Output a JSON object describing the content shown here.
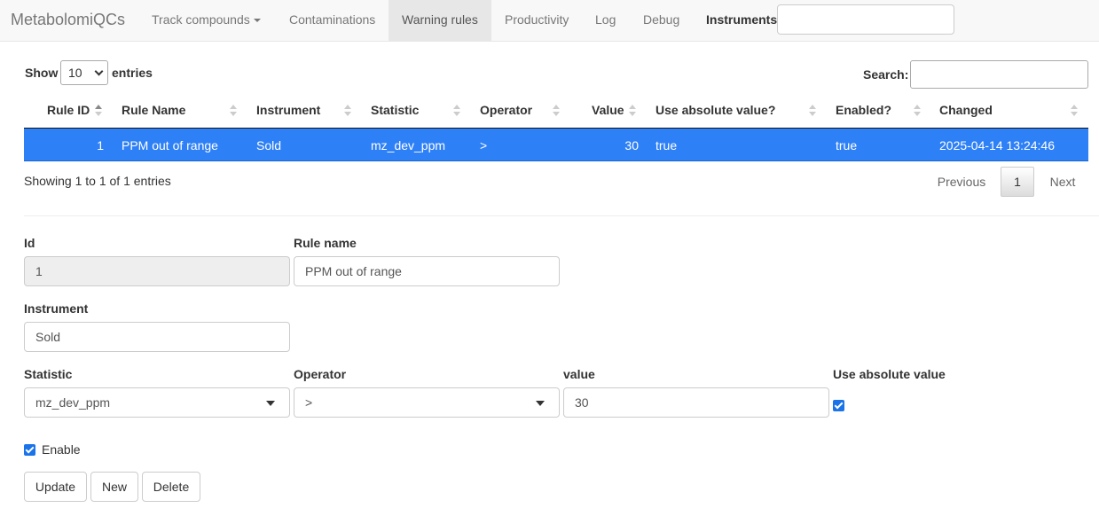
{
  "navbar": {
    "brand": "MetabolomiQCs",
    "items": [
      {
        "label": "Track compounds",
        "dropdown": true
      },
      {
        "label": "Contaminations"
      },
      {
        "label": "Warning rules",
        "active": true
      },
      {
        "label": "Productivity"
      },
      {
        "label": "Log"
      },
      {
        "label": "Debug"
      }
    ],
    "instruments_label": "Instruments",
    "instruments_value": ""
  },
  "table": {
    "show_label": "Show",
    "length_value": "10",
    "entries_label": "entries",
    "search_label": "Search:",
    "search_value": "",
    "columns": [
      "Rule ID",
      "Rule Name",
      "Instrument",
      "Statistic",
      "Operator",
      "Value",
      "Use absolute value?",
      "Enabled?",
      "Changed"
    ],
    "rows": [
      {
        "rule_id": "1",
        "rule_name": "PPM out of range",
        "instrument": "Sold",
        "statistic": "mz_dev_ppm",
        "operator": ">",
        "value": "30",
        "use_absolute": "true",
        "enabled": "true",
        "changed": "2025-04-14 13:24:46"
      }
    ],
    "info": "Showing 1 to 1 of 1 entries",
    "pagination": {
      "previous": "Previous",
      "current": "1",
      "next": "Next"
    }
  },
  "form": {
    "id_label": "Id",
    "id_value": "1",
    "rule_name_label": "Rule name",
    "rule_name_value": "PPM out of range",
    "instrument_label": "Instrument",
    "instrument_value": "Sold",
    "statistic_label": "Statistic",
    "statistic_value": "mz_dev_ppm",
    "operator_label": "Operator",
    "operator_value": ">",
    "value_label": "value",
    "value_value": "30",
    "abs_label": "Use absolute value",
    "abs_checked": true,
    "enable_label": "Enable",
    "enable_checked": true,
    "buttons": {
      "update": "Update",
      "new": "New",
      "delete": "Delete"
    }
  },
  "colors": {
    "selected_row": "#2e80f7",
    "checkbox": "#1a73e8",
    "navbar_bg": "#f8f8f8"
  }
}
